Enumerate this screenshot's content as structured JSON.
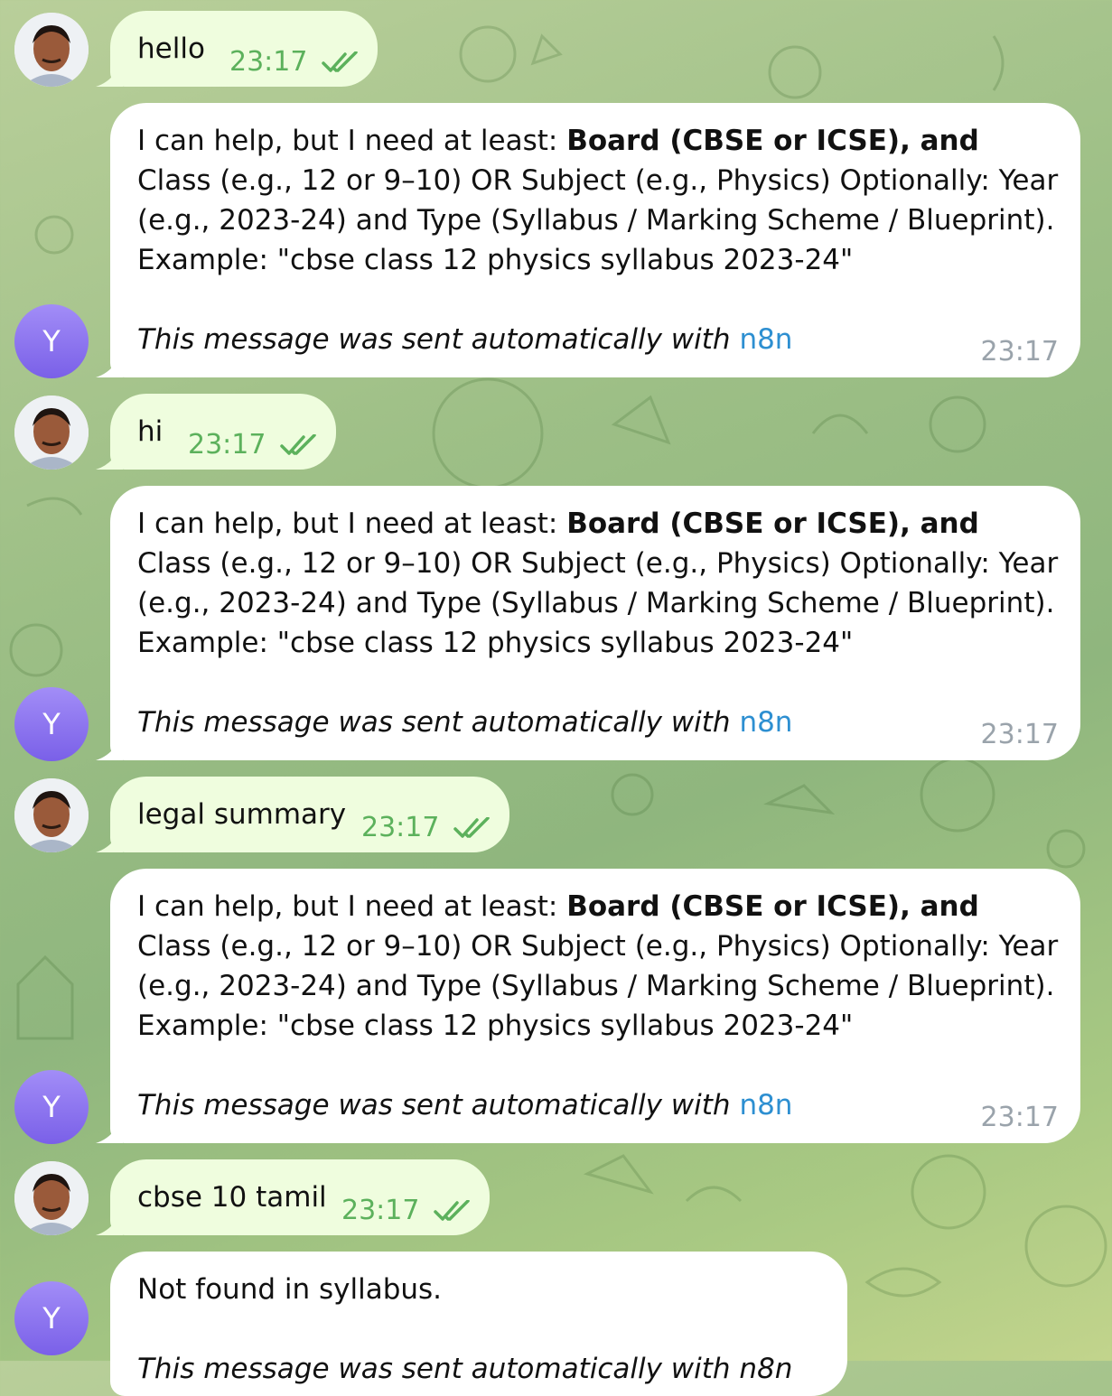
{
  "theme": {
    "outgoing_bg": "#effdde",
    "incoming_bg": "#ffffff",
    "check_color": "#5cb15c",
    "link_color": "#2d8fd1",
    "bot_avatar_color": "#8b74f0"
  },
  "bot": {
    "avatar_letter": "Y"
  },
  "reply": {
    "lead": "I can help, but I need at least: ",
    "bold": "Board (CBSE or ICSE), and",
    "rest": " Class (e.g., 12 or 9–10) OR Subject (e.g., Physics)  Optionally: Year (e.g., 2023-24) and Type (Syllabus / Marking Scheme / Blueprint).  Example: \"cbse class 12 physics syllabus 2023-24\"",
    "auto_prefix": "This message was sent automatically with ",
    "auto_link": "n8n",
    "time": "23:17"
  },
  "messages": [
    {
      "text": "hello",
      "time": "23:17",
      "status_icon": "double-check-icon"
    },
    {
      "text": "hi",
      "time": "23:17",
      "status_icon": "double-check-icon"
    },
    {
      "text": "legal summary",
      "time": "23:17",
      "status_icon": "double-check-icon"
    },
    {
      "text": "cbse 10 tamil",
      "time": "23:17",
      "status_icon": "double-check-icon"
    }
  ],
  "last_reply": {
    "text": "Not found in syllabus.",
    "auto_partial": "This message was sent automatically with n8n"
  }
}
